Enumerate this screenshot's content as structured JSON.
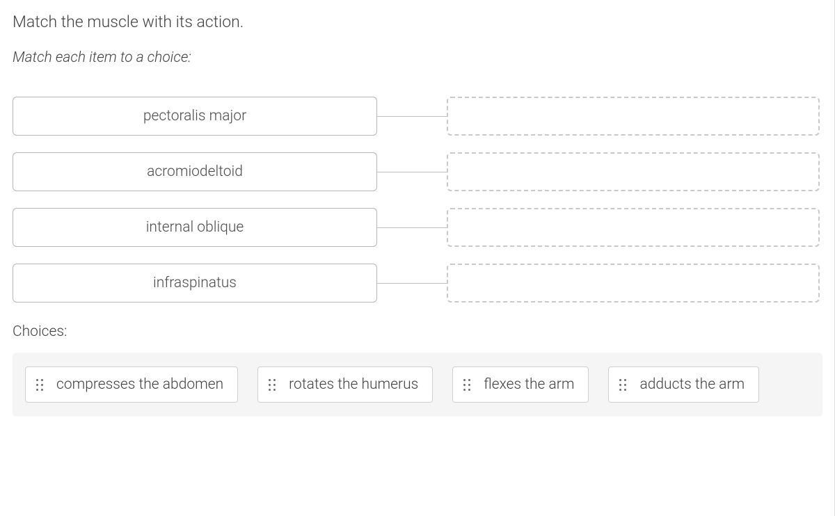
{
  "question": {
    "title": "Match the muscle with its action.",
    "instruction": "Match each item to a choice:"
  },
  "prompts": [
    {
      "label": "pectoralis major"
    },
    {
      "label": "acromiodeltoid"
    },
    {
      "label": "internal oblique"
    },
    {
      "label": "infraspinatus"
    }
  ],
  "choices_label": "Choices:",
  "choices": [
    {
      "label": "compresses the abdomen"
    },
    {
      "label": "rotates the humerus"
    },
    {
      "label": "flexes the arm"
    },
    {
      "label": "adducts the arm"
    }
  ]
}
